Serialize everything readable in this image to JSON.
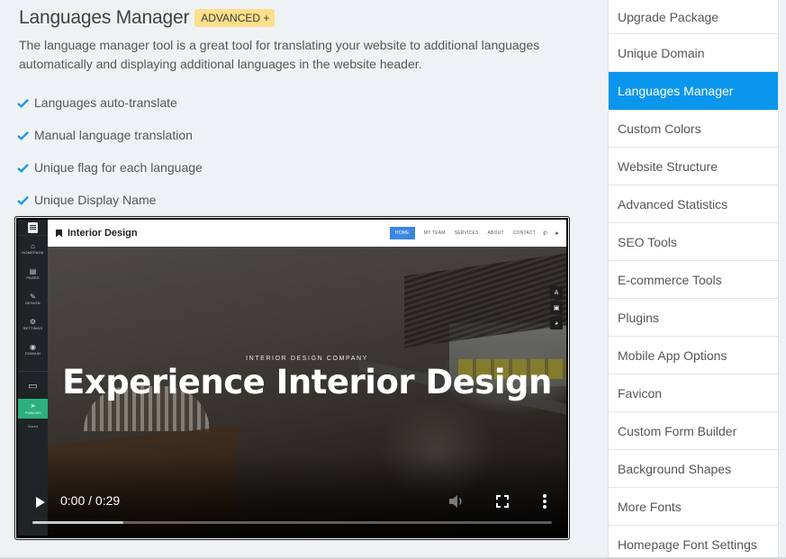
{
  "page": {
    "title": "Languages Manager",
    "badge": "ADVANCED +",
    "description": "The language manager tool is a great tool for translating your website to additional languages automatically and displaying additional languages in the website header.",
    "features": [
      "Languages auto-translate",
      "Manual language translation",
      "Unique flag for each language",
      "Unique Display Name"
    ],
    "accent_color": "#0a96ec",
    "check_color": "#1e9be0"
  },
  "video": {
    "editor_sidebar": {
      "items": [
        {
          "icon": "home-icon",
          "glyph": "⌂",
          "label": "HOMEPAGE"
        },
        {
          "icon": "pages-icon",
          "glyph": "▤",
          "label": "PAGES"
        },
        {
          "icon": "brush-icon",
          "glyph": "✎",
          "label": "DESIGN"
        },
        {
          "icon": "settings-icon",
          "glyph": "⚙",
          "label": "SETTINGS"
        },
        {
          "icon": "globe-icon",
          "glyph": "◉",
          "label": "DOMAIN"
        }
      ],
      "desktop_glyph": "▭",
      "publish_label": "PUBLISH",
      "publish_glyph": "➤",
      "small_label": "Saved"
    },
    "site": {
      "logo": "Interior Design",
      "nav": [
        "HOME",
        "MY TEAM",
        "SERVICES",
        "ABOUT",
        "CONTACT"
      ],
      "active_nav": "HOME",
      "phone_glyph": "✆",
      "send_glyph": "➤",
      "hero_tagline": "INTERIOR   DESIGN   COMPANY",
      "hero_title": "Experience Interior Design",
      "tools": [
        "A",
        "▣",
        "◕"
      ]
    },
    "player": {
      "time": "0:00 / 0:29",
      "buffered_fraction": 0.175
    }
  },
  "sidebar": {
    "items": [
      "Upgrade Package",
      "Unique Domain",
      "Languages Manager",
      "Custom Colors",
      "Website Structure",
      "Advanced Statistics",
      "SEO Tools",
      "E-commerce Tools",
      "Plugins",
      "Mobile App Options",
      "Favicon",
      "Custom Form Builder",
      "Background Shapes",
      "More Fonts",
      "Homepage Font Settings"
    ],
    "active_index": 2
  }
}
